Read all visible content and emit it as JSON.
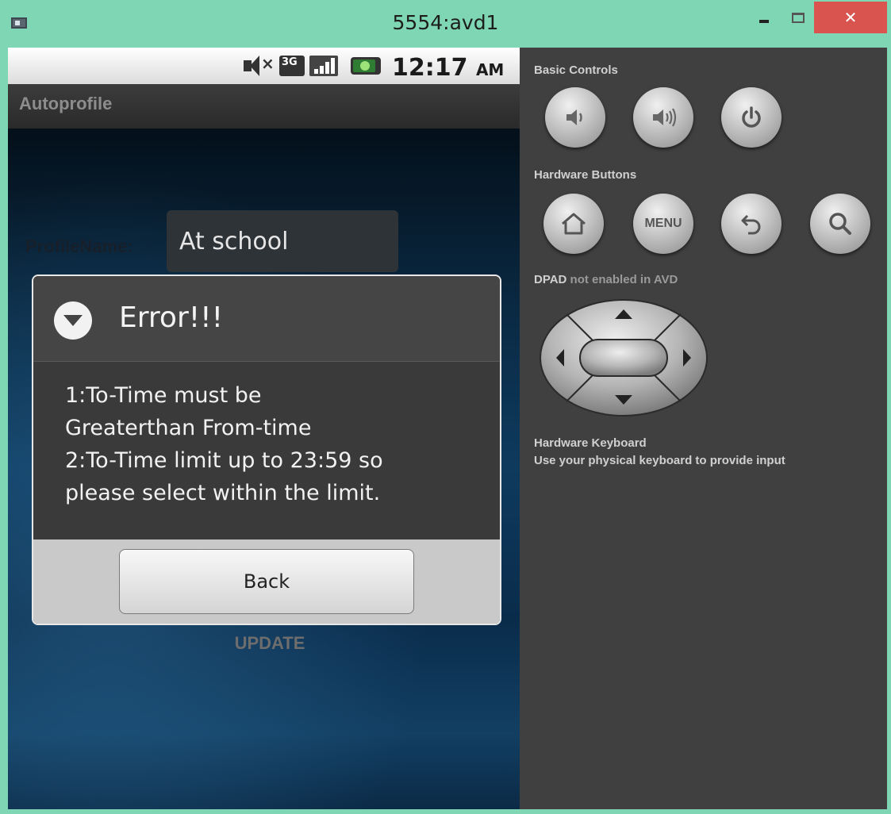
{
  "window": {
    "title": "5554:avd1",
    "close_glyph": "✕"
  },
  "statusbar": {
    "network_label": "3G",
    "time": "12:17",
    "ampm": "AM",
    "icons": [
      "mute-icon",
      "network-3g-icon",
      "signal-icon",
      "battery-icon"
    ]
  },
  "app": {
    "title": "Autoprofile",
    "profile_label": "ProfileName:",
    "profile_value": "At school",
    "update_label": "UPDATE"
  },
  "dialog": {
    "title": "Error!!!",
    "message_lines": [
      "1:To-Time must be",
      "Greaterthan From-time",
      "2:To-Time limit up to 23:59 so",
      "please select within the limit."
    ],
    "button_label": "Back"
  },
  "panel": {
    "basic_controls_label": "Basic Controls",
    "hardware_buttons_label": "Hardware Buttons",
    "menu_label": "MENU",
    "dpad_label_bold": "DPAD",
    "dpad_label_rest": " not enabled in AVD",
    "keyboard_label": "Hardware Keyboard",
    "keyboard_desc": "Use your physical keyboard to provide input"
  },
  "colors": {
    "window_frame": "#7ed6b4",
    "close_button": "#d9534f",
    "panel_bg": "#404040",
    "dialog_bg": "#3a3a3a"
  }
}
